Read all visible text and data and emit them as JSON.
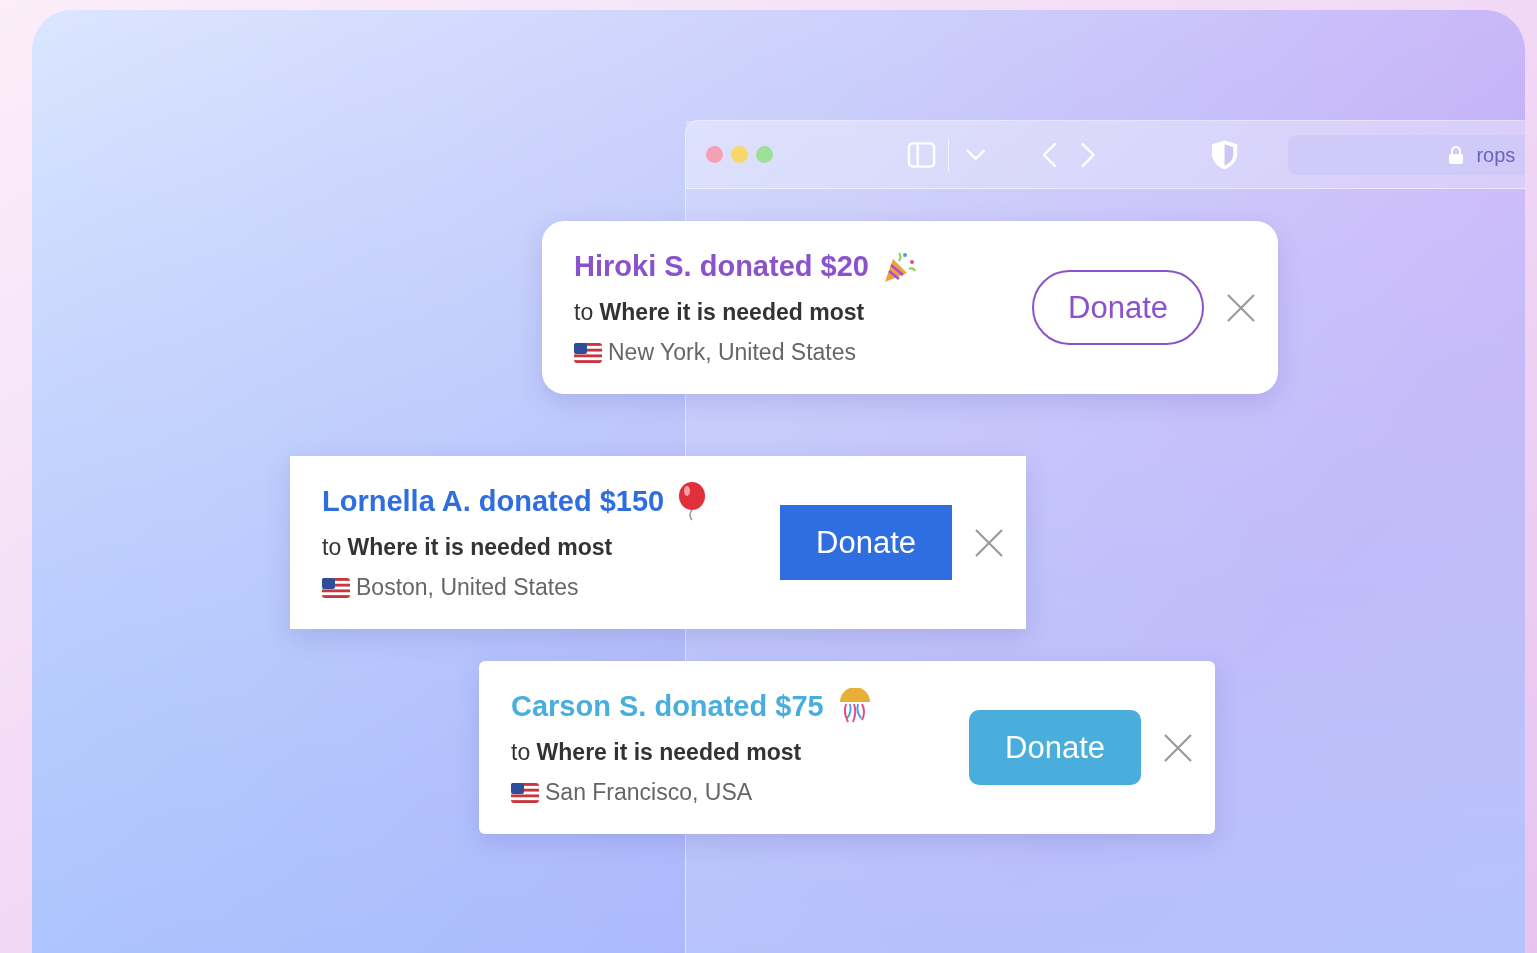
{
  "browser": {
    "address": "rops"
  },
  "notifications": [
    {
      "kind": "pill-outline",
      "color": "#8a52cc",
      "title": "Hiroki S. donated $20",
      "subtitle": "to **Where it is needed most**",
      "location": "New York, United States",
      "button": "Donate"
    },
    {
      "kind": "square-filled",
      "color": "#2f6ee0",
      "title": "Lornella A. donated $150",
      "subtitle": "to **Where it is needed most**",
      "location": "Boston, United States",
      "button": "Donate"
    },
    {
      "kind": "rounded-filled",
      "color": "#4aaedd",
      "title": "Carson S. donated $75",
      "subtitle": "to **Where it is needed most**",
      "location": "San Francisco, USA",
      "button": "Donate"
    }
  ]
}
